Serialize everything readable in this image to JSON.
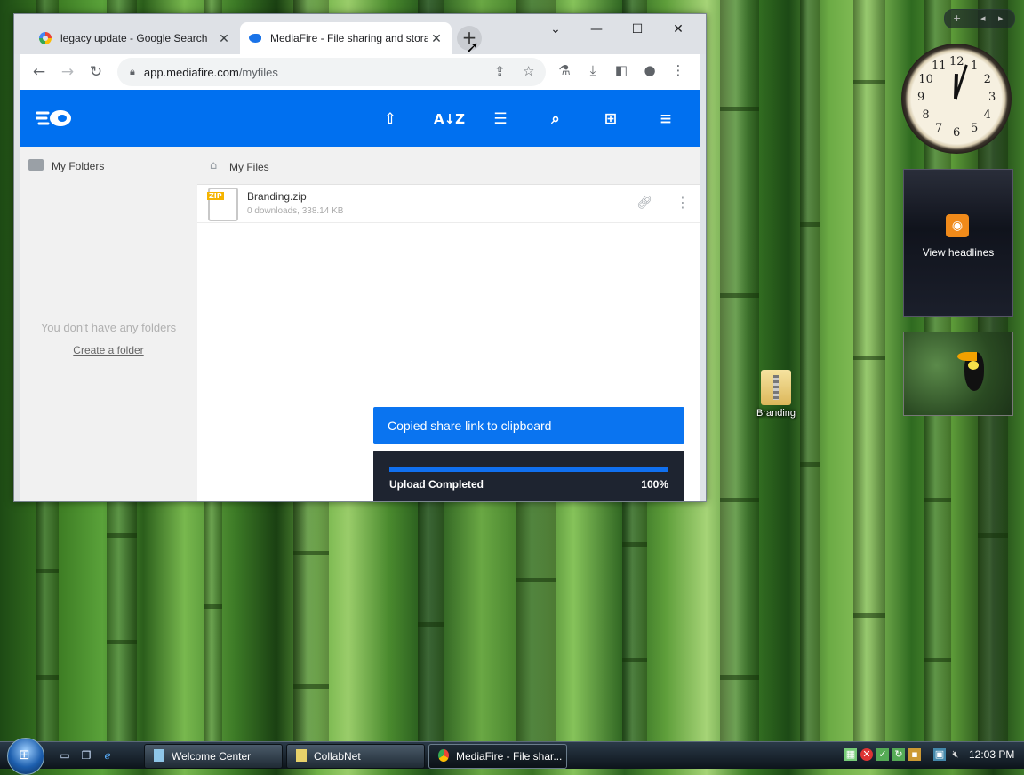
{
  "browser": {
    "tabs": [
      {
        "title": "legacy update - Google Search",
        "icon": "google-icon"
      },
      {
        "title": "MediaFire - File sharing and storage",
        "icon": "mediafire-icon"
      }
    ],
    "address": {
      "domain": "app.mediafire.com",
      "path": "/myfiles"
    }
  },
  "mediafire": {
    "sidebar": {
      "title": "My Folders",
      "empty_text": "You don't have any folders",
      "create_link": "Create a folder"
    },
    "breadcrumb": "My Files",
    "files": [
      {
        "name": "Branding.zip",
        "meta": "0 downloads, 338.14 KB",
        "type_tag": "ZIP"
      }
    ],
    "toast": "Copied share link to clipboard",
    "upload": {
      "label": "Upload Completed",
      "percent_text": "100%",
      "progress": 1.0
    },
    "colors": {
      "brand": "#0070f0",
      "toast": "#0a74f0",
      "upload_panel": "#1e2430"
    }
  },
  "desktop": {
    "gadgets": {
      "clock_numbers": [
        "12",
        "1",
        "2",
        "3",
        "4",
        "5",
        "6",
        "7",
        "8",
        "9",
        "10",
        "11"
      ],
      "feed_label": "View headlines",
      "control_plus": "+"
    },
    "icons": [
      {
        "label": "Branding"
      }
    ]
  },
  "taskbar": {
    "tasks": [
      {
        "label": "Welcome Center"
      },
      {
        "label": "CollabNet"
      },
      {
        "label": "MediaFire - File shar..."
      }
    ],
    "time": "12:03 PM"
  }
}
